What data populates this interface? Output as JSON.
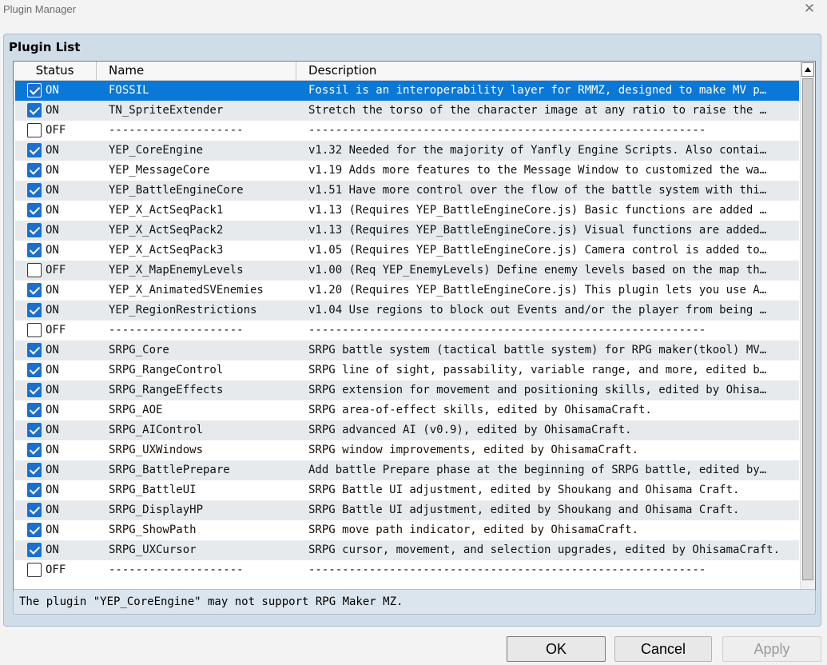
{
  "window": {
    "title": "Plugin Manager",
    "close_icon": "close-icon"
  },
  "panel": {
    "title": "Plugin List"
  },
  "table": {
    "headers": {
      "status": "Status",
      "name": "Name",
      "description": "Description"
    },
    "rows": [
      {
        "on": true,
        "status": "ON",
        "name": "FOSSIL",
        "description": "Fossil is an interoperability layer for RMMZ, designed to make MV p…"
      },
      {
        "on": true,
        "status": "ON",
        "name": "TN_SpriteExtender",
        "description": "Stretch the torso of the character image at any ratio to raise the …"
      },
      {
        "on": false,
        "status": "OFF",
        "name": "--------------------",
        "description": "-----------------------------------------------------------"
      },
      {
        "on": true,
        "status": "ON",
        "name": "YEP_CoreEngine",
        "description": "v1.32 Needed for the majority of Yanfly Engine Scripts. Also contai…"
      },
      {
        "on": true,
        "status": "ON",
        "name": "YEP_MessageCore",
        "description": "v1.19 Adds more features to the Message Window to customized the wa…"
      },
      {
        "on": true,
        "status": "ON",
        "name": "YEP_BattleEngineCore",
        "description": "v1.51 Have more control over the flow of the battle system with thi…"
      },
      {
        "on": true,
        "status": "ON",
        "name": "YEP_X_ActSeqPack1",
        "description": "v1.13 (Requires YEP_BattleEngineCore.js) Basic functions are added …"
      },
      {
        "on": true,
        "status": "ON",
        "name": "YEP_X_ActSeqPack2",
        "description": "v1.13 (Requires YEP_BattleEngineCore.js) Visual functions are added…"
      },
      {
        "on": true,
        "status": "ON",
        "name": "YEP_X_ActSeqPack3",
        "description": "v1.05 (Requires YEP_BattleEngineCore.js) Camera control is added to…"
      },
      {
        "on": false,
        "status": "OFF",
        "name": "YEP_X_MapEnemyLevels",
        "description": "v1.00 (Req YEP_EnemyLevels) Define enemy levels based on the map th…"
      },
      {
        "on": true,
        "status": "ON",
        "name": "YEP_X_AnimatedSVEnemies",
        "description": "v1.20 (Requires YEP_BattleEngineCore.js) This plugin lets you use A…"
      },
      {
        "on": true,
        "status": "ON",
        "name": "YEP_RegionRestrictions",
        "description": "v1.04 Use regions to block out Events and/or the player from being …"
      },
      {
        "on": false,
        "status": "OFF",
        "name": "--------------------",
        "description": "-----------------------------------------------------------"
      },
      {
        "on": true,
        "status": "ON",
        "name": "SRPG_Core",
        "description": "SRPG battle system (tactical battle system) for RPG maker(tkool) MV…"
      },
      {
        "on": true,
        "status": "ON",
        "name": "SRPG_RangeControl",
        "description": "SRPG line of sight, passability, variable range, and more, edited b…"
      },
      {
        "on": true,
        "status": "ON",
        "name": "SRPG_RangeEffects",
        "description": "SRPG extension for movement and positioning skills, edited by Ohisa…"
      },
      {
        "on": true,
        "status": "ON",
        "name": "SRPG_AOE",
        "description": "SRPG area-of-effect skills, edited by OhisamaCraft."
      },
      {
        "on": true,
        "status": "ON",
        "name": "SRPG_AIControl",
        "description": "SRPG advanced AI (v0.9), edited by OhisamaCraft."
      },
      {
        "on": true,
        "status": "ON",
        "name": "SRPG_UXWindows",
        "description": "SRPG window improvements, edited by OhisamaCraft."
      },
      {
        "on": true,
        "status": "ON",
        "name": "SRPG_BattlePrepare",
        "description": "Add battle Prepare phase at the beginning of SRPG battle, edited by…"
      },
      {
        "on": true,
        "status": "ON",
        "name": "SRPG_BattleUI",
        "description": "SRPG Battle UI adjustment, edited by Shoukang and Ohisama Craft."
      },
      {
        "on": true,
        "status": "ON",
        "name": "SRPG_DisplayHP",
        "description": "SRPG Battle UI adjustment, edited by Shoukang and Ohisama Craft."
      },
      {
        "on": true,
        "status": "ON",
        "name": "SRPG_ShowPath",
        "description": "SRPG move path indicator, edited by OhisamaCraft."
      },
      {
        "on": true,
        "status": "ON",
        "name": "SRPG_UXCursor",
        "description": "SRPG cursor, movement, and selection upgrades, edited by OhisamaCraft."
      },
      {
        "on": false,
        "status": "OFF",
        "name": "--------------------",
        "description": "-----------------------------------------------------------"
      }
    ]
  },
  "message": "The plugin \"YEP_CoreEngine\" may not support RPG Maker MZ.",
  "buttons": {
    "ok": "OK",
    "cancel": "Cancel",
    "apply": "Apply"
  },
  "colors": {
    "selection": "#0a78d7",
    "checkbox": "#1b6fd0",
    "panel": "#cfdde9"
  }
}
